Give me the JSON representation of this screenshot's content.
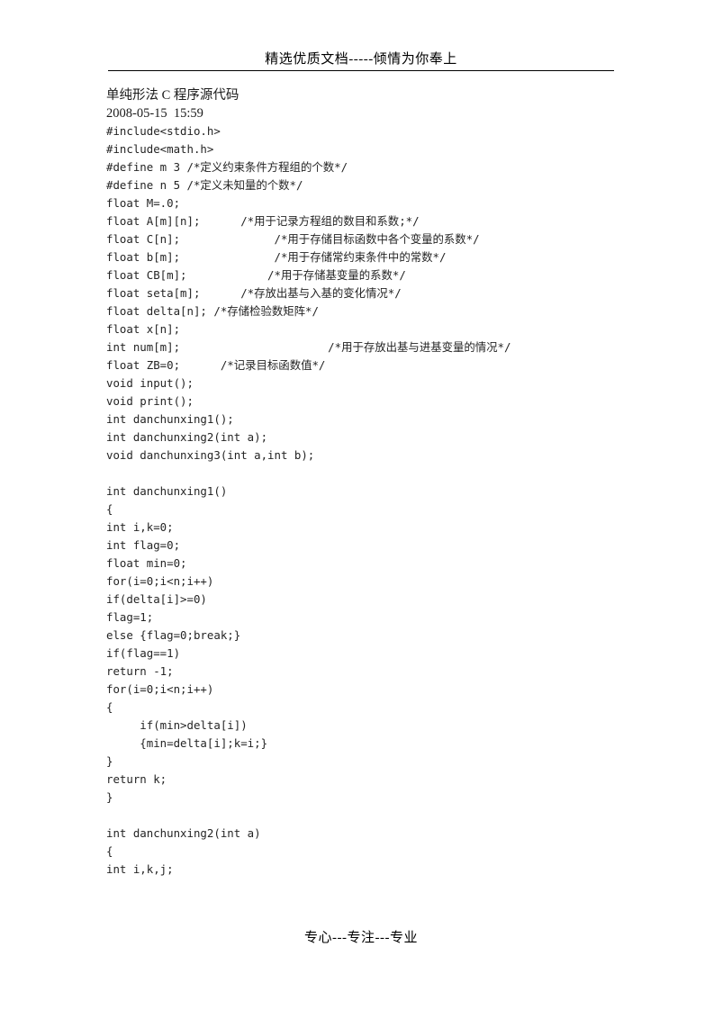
{
  "header": {
    "banner_text": "精选优质文档-----倾情为你奉上"
  },
  "document": {
    "title": "单纯形法 C 程序源代码",
    "timestamp": "2008-05-15  15:59",
    "code_lines": [
      "#include<stdio.h>",
      "#include<math.h>",
      "#define m 3 /*定义约束条件方程组的个数*/",
      "#define n 5 /*定义未知量的个数*/",
      "float M=.0;",
      "float A[m][n];      /*用于记录方程组的数目和系数;*/",
      "float C[n];              /*用于存储目标函数中各个变量的系数*/",
      "float b[m];              /*用于存储常约束条件中的常数*/",
      "float CB[m];            /*用于存储基变量的系数*/",
      "float seta[m];      /*存放出基与入基的变化情况*/",
      "float delta[n]; /*存储检验数矩阵*/",
      "float x[n];",
      "int num[m];                      /*用于存放出基与进基变量的情况*/",
      "float ZB=0;      /*记录目标函数值*/",
      "void input();",
      "void print();",
      "int danchunxing1();",
      "int danchunxing2(int a);",
      "void danchunxing3(int a,int b);",
      "",
      "int danchunxing1()",
      "{",
      "int i,k=0;",
      "int flag=0;",
      "float min=0;",
      "for(i=0;i<n;i++)",
      "if(delta[i]>=0)",
      "flag=1;",
      "else {flag=0;break;}",
      "if(flag==1)",
      "return -1;",
      "for(i=0;i<n;i++)",
      "{",
      "     if(min>delta[i])",
      "     {min=delta[i];k=i;}",
      "}",
      "return k;",
      "}",
      "",
      "int danchunxing2(int a)",
      "{",
      "int i,k,j;"
    ]
  },
  "footer": {
    "text": "专心---专注---专业"
  }
}
